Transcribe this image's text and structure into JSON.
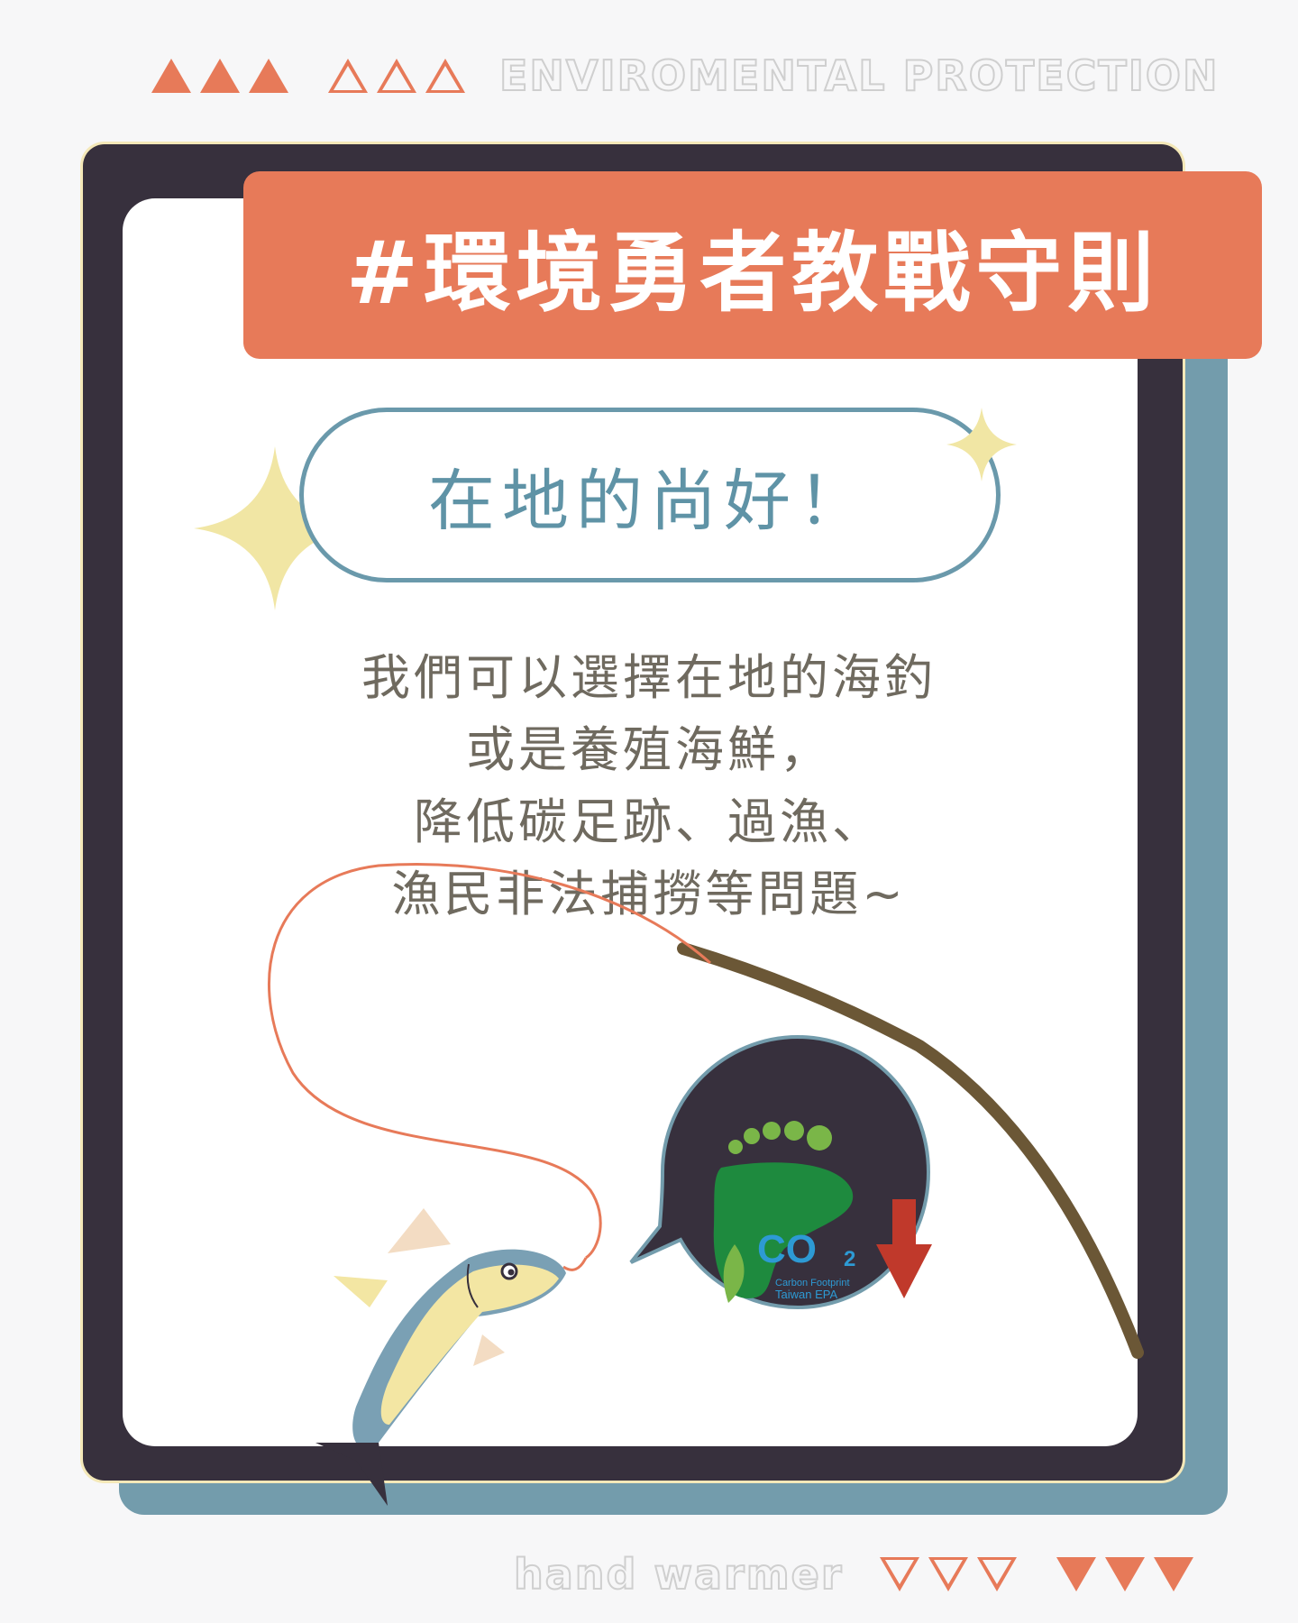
{
  "header": {
    "deco_text": "ENVIROMENTAL PROTECTION"
  },
  "title": "#環境勇者教戰守則",
  "subtitle": "在地的尚好！",
  "body_lines": [
    "我們可以選擇在地的海釣",
    "或是養殖海鮮，",
    "降低碳足跡、過漁、",
    "漁民非法捕撈等問題~"
  ],
  "badge": {
    "co2_label": "CO",
    "co2_sub": "2",
    "line1": "Carbon Footprint",
    "line2": "Taiwan EPA"
  },
  "footer": {
    "deco_text": "hand warmer"
  },
  "colors": {
    "accent": "#e77a59",
    "frame": "#37303d",
    "shadow": "#739cac",
    "pill_text": "#5f93a6",
    "body_text": "#6f6a5f",
    "sparkle": "#f1e6a4"
  }
}
